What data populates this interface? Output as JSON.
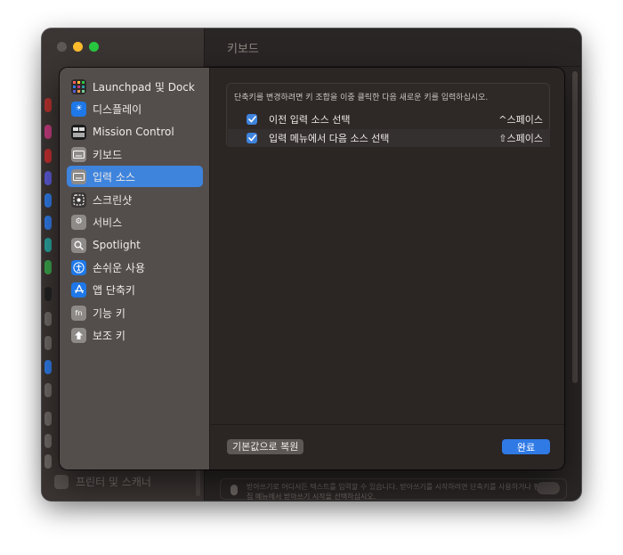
{
  "window": {
    "title": "키보드",
    "background_sidebar_bottom_label": "프린터 및 스캐너",
    "dictation_hint": "받아쓰기로 어디서든 텍스트를 입력할 수 있습니다. 받아쓰기를 시작하려면 단축키를 사용하거나 편집 메뉴에서 받아쓰기 시작을 선택하십시오."
  },
  "sidebar": {
    "items": [
      {
        "label": "Launchpad 및 Dock",
        "icon": "launchpad-icon",
        "color": "#2d2a2a"
      },
      {
        "label": "디스플레이",
        "icon": "display-icon",
        "color": "#1e78e8"
      },
      {
        "label": "Mission Control",
        "icon": "mission-control-icon",
        "color": "#1c1c1c"
      },
      {
        "label": "키보드",
        "icon": "keyboard-icon",
        "color": "#8e8a88"
      },
      {
        "label": "입력 소스",
        "icon": "input-sources-icon",
        "color": "#8e8a88",
        "selected": true
      },
      {
        "label": "스크린샷",
        "icon": "screenshot-icon",
        "color": "#3a3636"
      },
      {
        "label": "서비스",
        "icon": "services-icon",
        "color": "#8e8a88"
      },
      {
        "label": "Spotlight",
        "icon": "spotlight-icon",
        "color": "#8e8a88"
      },
      {
        "label": "손쉬운 사용",
        "icon": "accessibility-icon",
        "color": "#1e78e8"
      },
      {
        "label": "앱 단축키",
        "icon": "app-shortcuts-icon",
        "color": "#1e78e8"
      },
      {
        "label": "기능 키",
        "icon": "function-keys-icon",
        "color": "#8e8a88"
      },
      {
        "label": "보조 키",
        "icon": "modifier-keys-icon",
        "color": "#8e8a88"
      }
    ]
  },
  "main": {
    "instruction": "단축키를 변경하려면 키 조합을 이중 클릭한 다음 새로운 키를 입력하십시오.",
    "shortcuts": [
      {
        "label": "이전 입력 소스 선택",
        "key": "^스페이스",
        "checked": true
      },
      {
        "label": "입력 메뉴에서 다음 소스 선택",
        "key": "⇧스페이스",
        "checked": true
      }
    ],
    "restore_label": "기본값으로 복원",
    "done_label": "완료"
  },
  "colors": {
    "accent": "#3e84dd",
    "done_button": "#2f7ae5"
  }
}
